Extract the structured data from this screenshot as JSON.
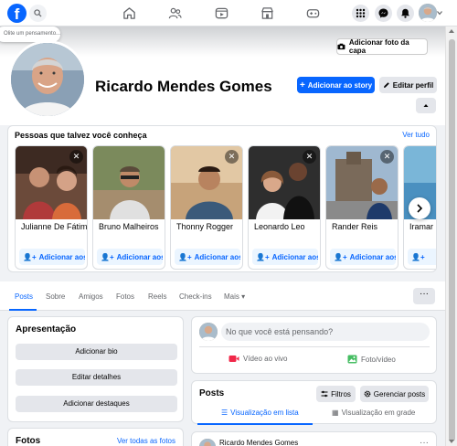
{
  "topbar": {
    "logo_letter": "f",
    "icons": [
      "facebook-logo",
      "search-icon",
      "home-icon",
      "friends-icon",
      "video-icon",
      "marketplace-icon",
      "gaming-icon",
      "menu-grid-icon",
      "messenger-icon",
      "notifications-icon",
      "avatar"
    ]
  },
  "cover": {
    "tooltip": "Olite um pensamento...",
    "add_cover_label": "Adicionar foto da capa"
  },
  "profile": {
    "name": "Ricardo Mendes Gomes",
    "add_story_label": "Adicionar ao story",
    "edit_profile_label": "Editar perfil"
  },
  "suggestions": {
    "title": "Pessoas que talvez você conheça",
    "see_all": "Ver tudo",
    "add_label": "Adicionar aos a...",
    "people": [
      {
        "name": "Julianne De Fátima"
      },
      {
        "name": "Bruno Malheiros"
      },
      {
        "name": "Thonny Rogger"
      },
      {
        "name": "Leonardo Leo"
      },
      {
        "name": "Rander Reis"
      },
      {
        "name": "Iramar"
      }
    ]
  },
  "tabs": {
    "items": [
      "Posts",
      "Sobre",
      "Amigos",
      "Fotos",
      "Reels",
      "Check-ins",
      "Mais ▾"
    ],
    "more": "···"
  },
  "intro": {
    "title": "Apresentação",
    "add_bio": "Adicionar bio",
    "edit_details": "Editar detalhes",
    "add_highlights": "Adicionar destaques"
  },
  "photos": {
    "title": "Fotos",
    "see_all": "Ver todas as fotos"
  },
  "composer": {
    "placeholder": "No que você está pensando?",
    "live_video": "Vídeo ao vivo",
    "photo_video": "Foto/vídeo"
  },
  "posts": {
    "title": "Posts",
    "filters": "Filtros",
    "manage": "Gerenciar posts",
    "list_view": "Visualização em lista",
    "grid_view": "Visualização em grade"
  },
  "post_preview": {
    "author": "Ricardo Mendes Gomes",
    "menu": "···"
  },
  "colors": {
    "brand": "#0866ff",
    "background": "#f0f2f5",
    "live_red": "#f02849",
    "photo_green": "#45bd62"
  }
}
